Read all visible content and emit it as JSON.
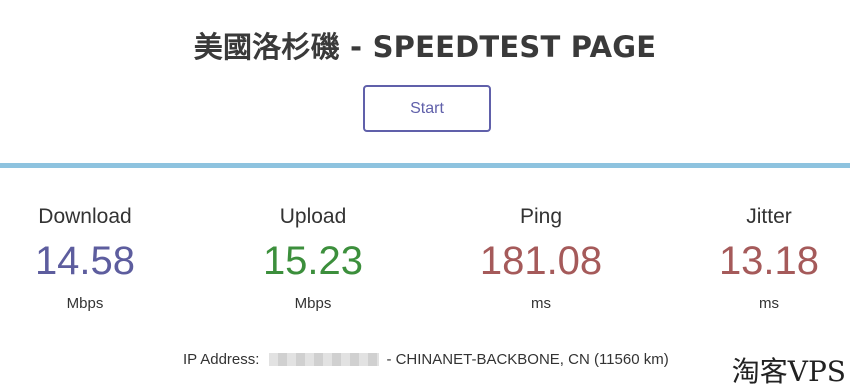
{
  "header": {
    "title": "美國洛杉磯 - SPEEDTEST PAGE"
  },
  "controls": {
    "start_label": "Start"
  },
  "metrics": [
    {
      "label": "Download",
      "value": "14.58",
      "unit": "Mbps",
      "color": "#5d5d9e"
    },
    {
      "label": "Upload",
      "value": "15.23",
      "unit": "Mbps",
      "color": "#3c8f3c"
    },
    {
      "label": "Ping",
      "value": "181.08",
      "unit": "ms",
      "color": "#a55a5a"
    },
    {
      "label": "Jitter",
      "value": "13.18",
      "unit": "ms",
      "color": "#a55a5a"
    }
  ],
  "ip_info": {
    "prefix": "IP Address:",
    "suffix": "- CHINANET-BACKBONE, CN (11560 km)"
  },
  "watermark": "淘客VPS",
  "colors": {
    "accent": "#6060aa",
    "divider": "#8ec3df"
  }
}
